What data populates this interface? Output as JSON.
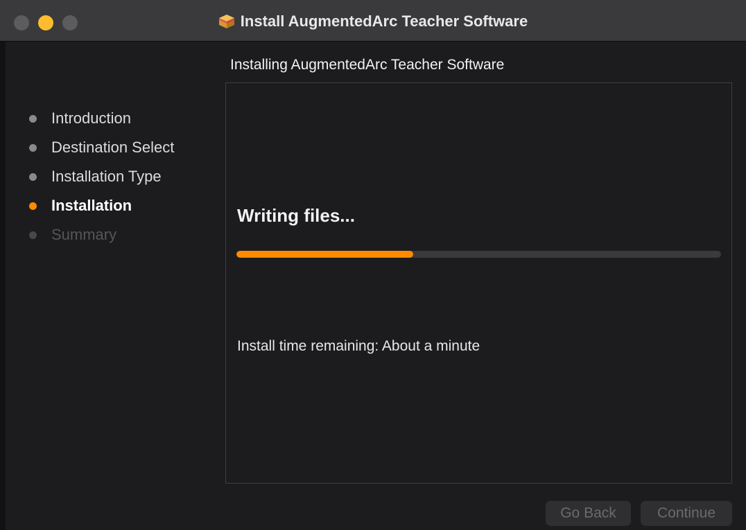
{
  "window": {
    "title": "Install AugmentedArc Teacher Software",
    "title_icon": "package-icon"
  },
  "traffic_lights": {
    "close_color": "#5c5c5e",
    "minimize_color": "#febc2e",
    "zoom_color": "#5c5c5e"
  },
  "sidebar": {
    "steps": [
      {
        "label": "Introduction",
        "state": "done"
      },
      {
        "label": "Destination Select",
        "state": "done"
      },
      {
        "label": "Installation Type",
        "state": "done"
      },
      {
        "label": "Installation",
        "state": "active"
      },
      {
        "label": "Summary",
        "state": "pending"
      }
    ]
  },
  "main": {
    "heading": "Installing AugmentedArc Teacher Software",
    "status_title": "Writing files...",
    "progress_fraction": 0.365,
    "time_remaining": "Install time remaining: About a minute"
  },
  "buttons": {
    "go_back": "Go Back",
    "continue": "Continue"
  },
  "colors": {
    "accent": "#ff8a00",
    "background": "#1c1c1e"
  }
}
